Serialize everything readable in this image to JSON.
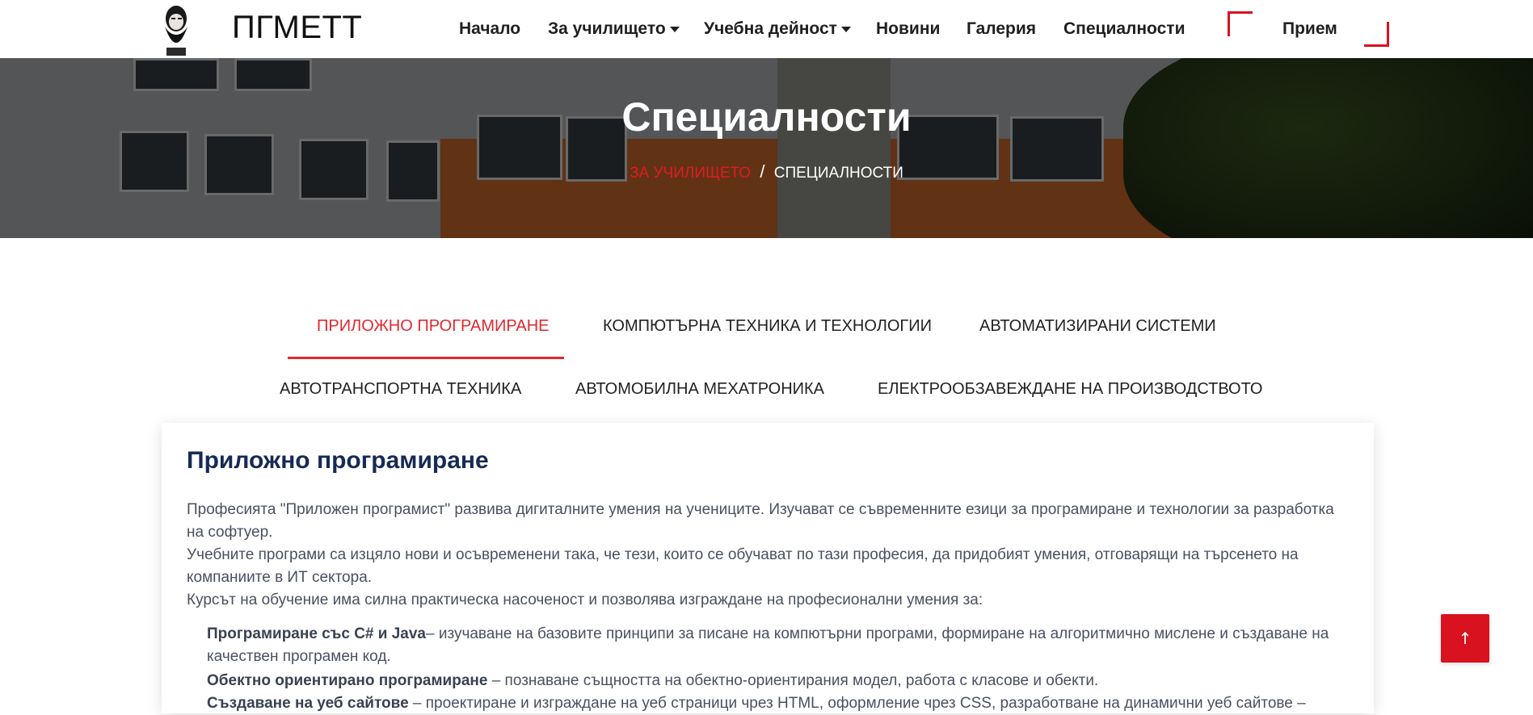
{
  "header": {
    "logo_text": "ПГМЕТТ",
    "nav": [
      {
        "label": "Начало",
        "dropdown": false
      },
      {
        "label": "За училището",
        "dropdown": true
      },
      {
        "label": "Учебна дейност",
        "dropdown": true
      },
      {
        "label": "Новини",
        "dropdown": false
      },
      {
        "label": "Галерия",
        "dropdown": false
      },
      {
        "label": "Специалности",
        "dropdown": false
      }
    ],
    "cta_label": "Прием"
  },
  "hero": {
    "title": "Специалности",
    "breadcrumb": {
      "link": "ЗА УЧИЛИЩЕТО",
      "separator": "/",
      "current": "СПЕЦИАЛНОСТИ"
    }
  },
  "tabs": [
    "ПРИЛОЖНО ПРОГРАМИРАНЕ",
    "КОМПЮТЪРНА ТЕХНИКА И ТЕХНОЛОГИИ",
    "АВТОМАТИЗИРАНИ СИСТЕМИ",
    "АВТОТРАНСПОРТНА ТЕХНИКА",
    "АВТОМОБИЛНА МЕХАТРОНИКА",
    "ЕЛЕКТРООБЗАВЕЖДАНЕ НА ПРОИЗВОДСТВОТО"
  ],
  "active_tab": "ПРИЛОЖНО ПРОГРАМИРАНЕ",
  "content": {
    "title": "Приложно програмиране",
    "paragraphs": [
      "Професията \"Приложен програмист\" развива дигиталните умения на учениците. Изучават се съвременните езици за програмиране и технологии за разработка на софтуер.",
      "Учебните програми са изцяло нови и осъвременени така, че тези, които се обучават по тази професия, да придобият умения, отговарящи на търсенето на компаниите в ИТ сектора.",
      "Курсът на обучение има силна практическа насоченост и позволява изграждане на професионални умения за:"
    ],
    "list": [
      {
        "term": "Програмиране със C# и Java",
        "text": "– изучаване на базовите принципи за писане на компютърни програми, формиране на алгоритмично мислене и създаване на качествен програмен код."
      },
      {
        "term": "Обектно ориентирано програмиране",
        "text": " – познаване същността на обектно-ориентирания модел, работа с класове и обекти."
      },
      {
        "term": "Създаване на уеб сайтове",
        "text": " – проектиране и изграждане на уеб страници чрез HTML, оформление чрез CSS, разработване на динамични уеб сайтове –"
      }
    ]
  },
  "scroll_top_icon": "↑",
  "colors": {
    "accent": "#d8121f",
    "title": "#162a56"
  }
}
